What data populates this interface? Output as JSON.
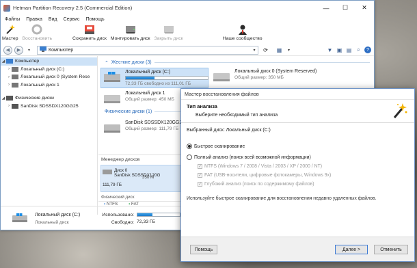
{
  "window": {
    "title": "Hetman Partition Recovery 2.5 (Commercial Edition)",
    "minimize": "—",
    "maximize": "☐",
    "close": "✕"
  },
  "menu": [
    "Файлы",
    "Правка",
    "Вид",
    "Сервис",
    "Помощь"
  ],
  "toolbar": {
    "wizard": "Мастер",
    "restore": "Восстановить",
    "save_disk": "Сохранить диск",
    "mount_disk": "Монтировать диск",
    "close_disk": "Закрыть диск",
    "community": "Наше сообщество"
  },
  "address": {
    "path": "Компьютер"
  },
  "tree": {
    "computer": "Компьютер",
    "items": [
      "Локальный диск (C:)",
      "Локальный диск 0 (System Rese",
      "Локальный диск 1"
    ],
    "physical_header": "Физические диски",
    "physical_items": [
      "SanDisk SDSSDX120GG25"
    ]
  },
  "drives": {
    "hard_section": "Жесткие диски (3)",
    "c_name": "Локальный диск (C:)",
    "c_free": "72,33 ГБ свободно из 111,01 ГБ",
    "c_fill": 0.35,
    "sysres_name": "Локальный диск 0 (System Reserved)",
    "sysres_size": "Общий размер: 350 МБ",
    "d1_name": "Локальный диск 1",
    "d1_size": "Общий размер: 450 МБ",
    "physical_section": "Физические диски (1)",
    "phys_name": "SanDisk SDSSDX120GG25",
    "phys_size": "Общий размер: 111,79 ГБ"
  },
  "disk_manager": {
    "title": "Менеджер дисков",
    "disk_label": "Диск 0",
    "disk_model": "SanDisk SDSSDX120G",
    "disk_size": "111,79 ГБ",
    "disk_type": "Физический диск",
    "part_size": "350 М",
    "legend": [
      "NTFS",
      "FAT"
    ]
  },
  "status": {
    "name": "Локальный диск (C:)",
    "type": "Локальный диск",
    "used_label": "Использовано:",
    "free_label": "Свободно:",
    "free_value": "72,33 ГБ",
    "used_fill": 0.35
  },
  "dialog": {
    "title": "Мастер восстановления файлов",
    "heading": "Тип анализа",
    "subheading": "Выберите необходимый тип анализа",
    "selected_disk": "Выбранный диск: Локальный диск (C:)",
    "fast_scan": "Быстрое сканирование",
    "full_scan": "Полный анализ (поиск всей возможной информации)",
    "opt_ntfs": "NTFS (Windows 7 / 2008 / Vista / 2003 / XP / 2000 / NT)",
    "opt_fat": "FAT (USB-носители, цифровые фотокамеры, Windows 9x)",
    "opt_deep": "Глубокий анализ (поиск по содержимому файлов)",
    "hint": "Используйте быстрое сканирование для восстановления недавно удаленных файлов.",
    "help_button": "Помощь",
    "next_button": "Далее >",
    "cancel_button": "Отменить"
  },
  "colors": {
    "accent": "#2a6cbc",
    "selection": "#cde2f7",
    "progress": "#1a79c9"
  }
}
